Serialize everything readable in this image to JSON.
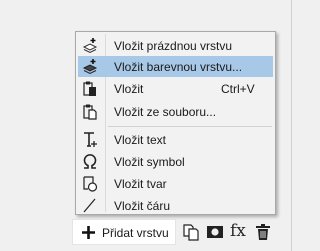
{
  "context_menu": {
    "items": [
      {
        "label": "Vložit prázdnou vrstvu",
        "icon": "new-layer-icon"
      },
      {
        "label": "Vložit barevnou vrstvu...",
        "icon": "color-layer-icon",
        "highlighted": true
      },
      {
        "label": "Vložit",
        "shortcut": "Ctrl+V",
        "icon": "paste-icon"
      },
      {
        "label": "Vložit ze souboru...",
        "icon": "paste-from-file-icon"
      },
      {
        "label": "Vložit text",
        "icon": "text-tool-icon"
      },
      {
        "label": "Vložit symbol",
        "icon": "omega-symbol-icon"
      },
      {
        "label": "Vložit tvar",
        "icon": "shape-icon"
      },
      {
        "label": "Vložit čáru",
        "icon": "line-icon"
      }
    ]
  },
  "bottom_toolbar": {
    "add_layer_label": "Přidat vrstvu",
    "fx_label": "fx",
    "icons": [
      "plus-icon",
      "duplicate-layer-icon",
      "layer-mask-icon",
      "fx-icon",
      "trash-icon"
    ]
  },
  "colors": {
    "highlight": "#a8c8e8",
    "menu_background": "#f2f2f2",
    "panel_background": "#f0f0f0"
  }
}
